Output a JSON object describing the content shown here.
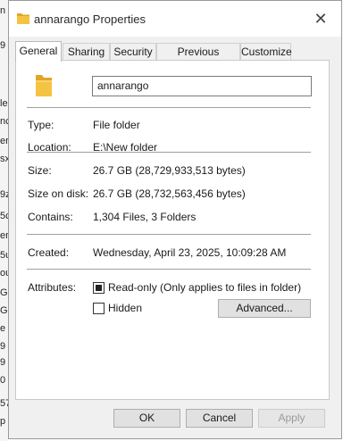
{
  "background_fragments": [
    "n",
    "9",
    "le",
    "nc",
    "er",
    "sx",
    "9z",
    "5c",
    "en",
    "5u",
    "ou",
    "G",
    "Gu",
    "e \\",
    "9",
    "9",
    "0",
    "57",
    "p"
  ],
  "window": {
    "title": "annarango Properties",
    "close_glyph": "✕"
  },
  "tabs": [
    {
      "label": "General",
      "active": true
    },
    {
      "label": "Sharing",
      "active": false
    },
    {
      "label": "Security",
      "active": false
    },
    {
      "label": "Previous Versions",
      "active": false
    },
    {
      "label": "Customize",
      "active": false
    }
  ],
  "general": {
    "name_value": "annarango",
    "type_label": "Type:",
    "type_value": "File folder",
    "location_label": "Location:",
    "location_value": "E:\\New folder",
    "size_label": "Size:",
    "size_value": "26.7 GB (28,729,933,513 bytes)",
    "size_on_disk_label": "Size on disk:",
    "size_on_disk_value": "26.7 GB (28,732,563,456 bytes)",
    "contains_label": "Contains:",
    "contains_value": "1,304 Files, 3 Folders",
    "created_label": "Created:",
    "created_value": "Wednesday, April 23, 2025, 10:09:28 AM",
    "attributes_label": "Attributes:",
    "readonly_label": "Read-only (Only applies to files in folder)",
    "readonly_state": "indeterminate",
    "hidden_label": "Hidden",
    "hidden_state": "unchecked",
    "advanced_label": "Advanced..."
  },
  "footer": {
    "ok_label": "OK",
    "cancel_label": "Cancel",
    "apply_label": "Apply",
    "apply_disabled": true
  },
  "colors": {
    "folder_yellow": "#f5c342",
    "folder_dark": "#e0a623",
    "dialog_bg": "#f0f0f0"
  }
}
